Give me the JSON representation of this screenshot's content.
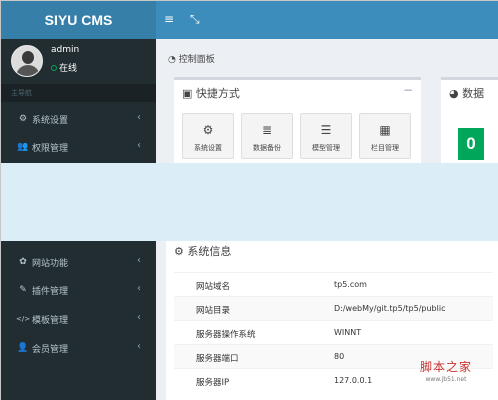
{
  "app": {
    "logo": "SIYU CMS"
  },
  "topbar": {
    "menu_icon": "≡",
    "fullscreen_icon": "⤡"
  },
  "user": {
    "name": "admin",
    "status": "在线"
  },
  "sidebar": {
    "header": "主导航",
    "items": [
      {
        "label": "系统设置",
        "icon": "⚙"
      },
      {
        "label": "权限管理",
        "icon": "👥"
      },
      {
        "label": "网站功能",
        "icon": "✿"
      },
      {
        "label": "插件管理",
        "icon": "✎"
      },
      {
        "label": "模板管理",
        "icon": "</>"
      },
      {
        "label": "会员管理",
        "icon": "👤"
      }
    ]
  },
  "breadcrumb": "控制面板",
  "shortcuts": {
    "title": "快捷方式",
    "collapse": "−",
    "items": [
      {
        "label": "系统设置",
        "icon": "⚙"
      },
      {
        "label": "数据备份",
        "icon": "≣"
      },
      {
        "label": "模型管理",
        "icon": "☰"
      },
      {
        "label": "栏目管理",
        "icon": "▦"
      }
    ]
  },
  "stats": {
    "title": "数据",
    "count": "0"
  },
  "system_info": {
    "title": "系统信息",
    "rows": [
      {
        "key": "网站域名",
        "value": "tp5.com"
      },
      {
        "key": "网站目录",
        "value": "D:/webMy/git.tp5/tp5/public"
      },
      {
        "key": "服务器操作系统",
        "value": "WINNT"
      },
      {
        "key": "服务器端口",
        "value": "80"
      },
      {
        "key": "服务器IP",
        "value": "127.0.0.1"
      }
    ]
  },
  "watermark": {
    "text": "脚本之家",
    "url": "www.jb51.net"
  },
  "colors": {
    "sidebar": "#222d32",
    "header": "#3c8dbc",
    "logo": "#367fa9",
    "success": "#00a65a"
  }
}
